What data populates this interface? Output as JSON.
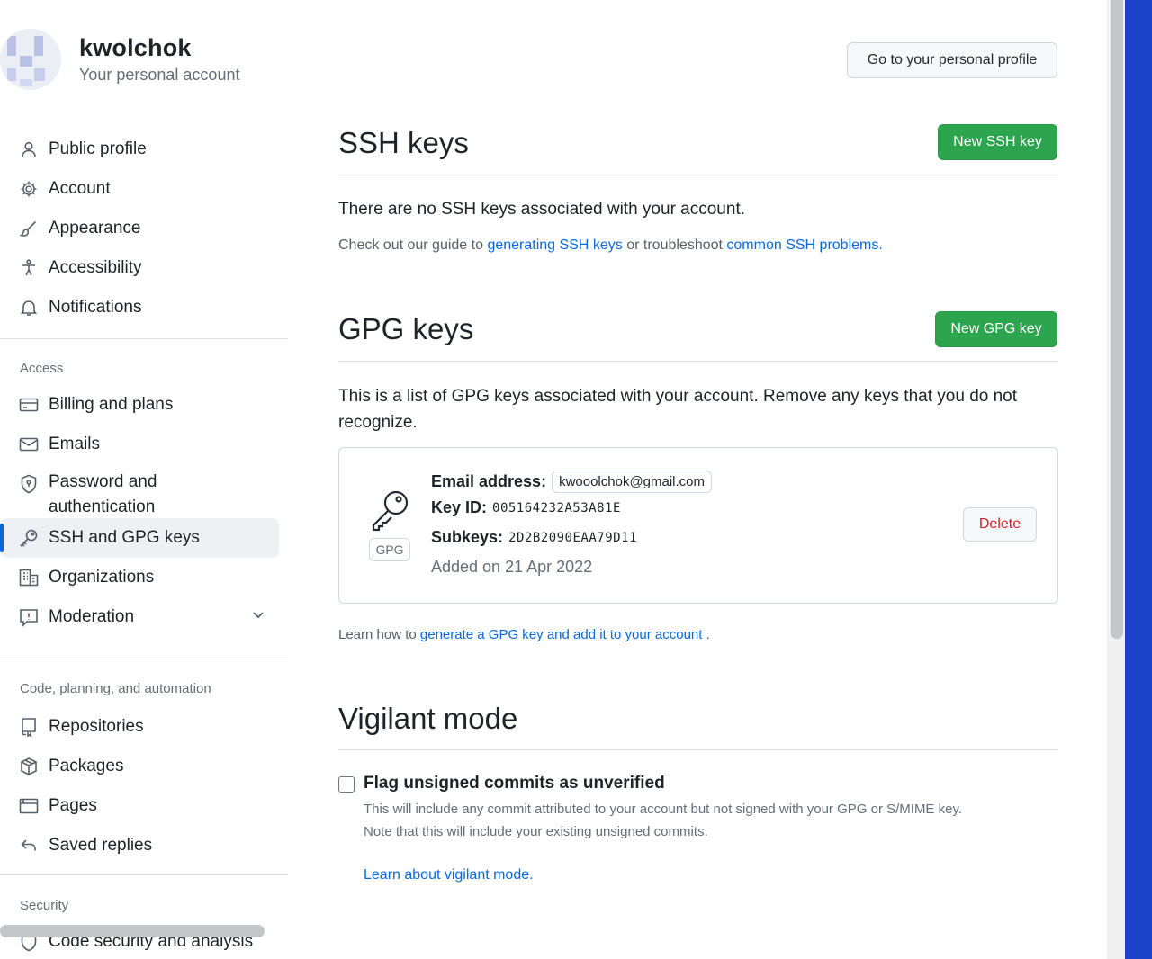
{
  "account": {
    "name": "kwolchok",
    "subtitle": "Your personal account"
  },
  "header": {
    "profile_button": "Go to your personal profile"
  },
  "sidebar": {
    "top_items": [
      {
        "label": "Public profile",
        "icon": "person-icon"
      },
      {
        "label": "Account",
        "icon": "gear-icon"
      },
      {
        "label": "Appearance",
        "icon": "paintbrush-icon"
      },
      {
        "label": "Accessibility",
        "icon": "accessibility-icon"
      },
      {
        "label": "Notifications",
        "icon": "bell-icon"
      }
    ],
    "access_heading": "Access",
    "access_items": [
      {
        "label": "Billing and plans",
        "icon": "credit-card-icon"
      },
      {
        "label": "Emails",
        "icon": "mail-icon"
      },
      {
        "label": "Password and authentication",
        "icon": "shield-lock-icon"
      },
      {
        "label": "SSH and GPG keys",
        "icon": "key-icon",
        "active": true
      },
      {
        "label": "Organizations",
        "icon": "organization-icon"
      },
      {
        "label": "Moderation",
        "icon": "report-icon"
      }
    ],
    "code_heading": "Code, planning, and automation",
    "code_items": [
      {
        "label": "Repositories",
        "icon": "repo-icon"
      },
      {
        "label": "Packages",
        "icon": "package-icon"
      },
      {
        "label": "Pages",
        "icon": "browser-icon"
      },
      {
        "label": "Saved replies",
        "icon": "reply-icon"
      }
    ],
    "security_heading": "Security",
    "security_items": [
      {
        "label": "Code security and analysis",
        "icon": "shield-icon"
      }
    ]
  },
  "ssh": {
    "title": "SSH keys",
    "new_button": "New SSH key",
    "empty_text": "There are no SSH keys associated with your account.",
    "guide_prefix": "Check out our guide to",
    "guide_link1": "generating SSH keys",
    "guide_middle": "or troubleshoot",
    "guide_link2": "common SSH problems."
  },
  "gpg": {
    "title": "GPG keys",
    "new_button": "New GPG key",
    "intro": "This is a list of GPG keys associated with your account. Remove any keys that you do not recognize.",
    "key": {
      "badge": "GPG",
      "email_label": "Email address:",
      "email": "kwooolchok@gmail.com",
      "key_id_label": "Key ID:",
      "key_id": "005164232A53A81E",
      "subkeys_label": "Subkeys:",
      "subkeys": "2D2B2090EAA79D11",
      "added": "Added on 21 Apr 2022",
      "delete_button": "Delete"
    },
    "learn_prefix": "Learn how to",
    "learn_link": "generate a GPG key and add it to your account",
    "learn_suffix": "."
  },
  "vigilant": {
    "title": "Vigilant mode",
    "checkbox_label": "Flag unsigned commits as unverified",
    "checked": false,
    "note_line1": "This will include any commit attributed to your account but not signed with your GPG or S/MIME key.",
    "note_line2": "Note that this will include your existing unsigned commits.",
    "learn_link": "Learn about vigilant mode."
  },
  "colors": {
    "primary_button": "#2da44e",
    "link": "#0969da",
    "danger": "#cf222e",
    "active_indicator": "#0969da"
  }
}
